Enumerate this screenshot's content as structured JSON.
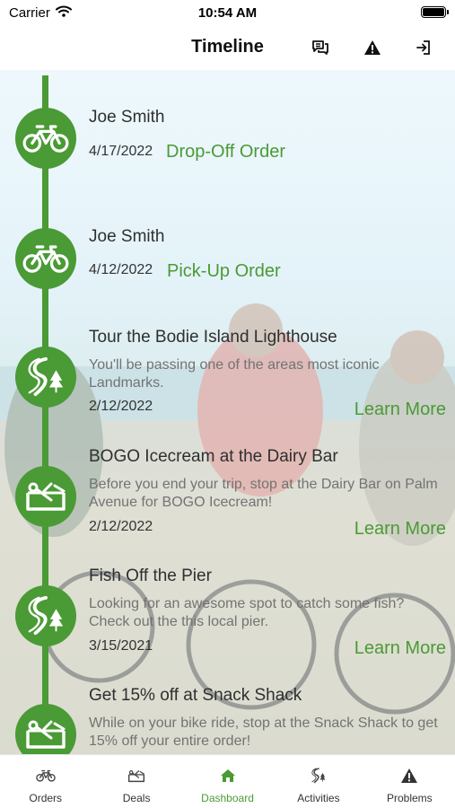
{
  "status_bar": {
    "carrier": "Carrier",
    "time": "10:54 AM"
  },
  "header": {
    "title": "Timeline"
  },
  "timeline": [
    {
      "kind": "order",
      "icon": "bike-icon",
      "title": "Joe Smith",
      "date": "4/17/2022",
      "order_type": "Drop-Off Order"
    },
    {
      "kind": "order",
      "icon": "bike-icon",
      "title": "Joe Smith",
      "date": "4/12/2022",
      "order_type": "Pick-Up Order"
    },
    {
      "kind": "activity",
      "icon": "trail-icon",
      "title": "Tour the Bodie Island Lighthouse",
      "description": "You'll be passing one of the areas most iconic Landmarks.",
      "date": "2/12/2022",
      "link": "Learn More"
    },
    {
      "kind": "deal",
      "icon": "ticket-icon",
      "title": "BOGO Icecream at the Dairy Bar",
      "description": "Before you end your trip, stop at the Dairy Bar on Palm Avenue for BOGO Icecream!",
      "date": "2/12/2022",
      "link": "Learn More"
    },
    {
      "kind": "activity",
      "icon": "trail-icon",
      "title": "Fish Off the Pier",
      "description": "Looking for an awesome spot to catch some fish? Check out the this local pier.",
      "date": "3/15/2021",
      "link": "Learn More"
    },
    {
      "kind": "deal",
      "icon": "ticket-icon",
      "title": "Get 15% off at Snack Shack",
      "description": "While on your bike ride, stop at the Snack Shack to get 15% off your entire order!"
    }
  ],
  "tab_bar": [
    {
      "label": "Orders",
      "icon": "bike-icon",
      "active": false
    },
    {
      "label": "Deals",
      "icon": "deals-icon",
      "active": false
    },
    {
      "label": "Dashboard",
      "icon": "home-icon",
      "active": true
    },
    {
      "label": "Activities",
      "icon": "activities-icon",
      "active": false
    },
    {
      "label": "Problems",
      "icon": "warning-icon",
      "active": false
    }
  ],
  "colors": {
    "accent": "#4a9a35",
    "text": "#2f2f2f",
    "muted": "#737373"
  }
}
